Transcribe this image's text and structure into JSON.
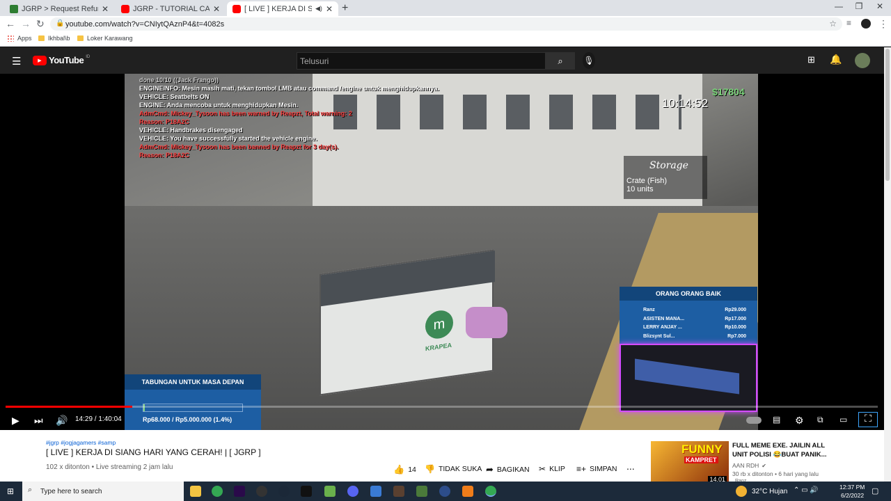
{
  "browser": {
    "tabs": [
      {
        "title": "JGRP > Request Refund - Jogjag",
        "favicon_color": "#2e7d32",
        "active": false
      },
      {
        "title": "JGRP - TUTORIAL CARA MEMBUA",
        "favicon_color": "#ff0000",
        "active": false
      },
      {
        "title": "[ LIVE ] KERJA DI SIANG HAR",
        "favicon_color": "#ff0000",
        "active": true
      }
    ],
    "url": "youtube.com/watch?v=CNIytQAznP4&t=4082s",
    "bookmarks": [
      "Apps",
      "Ikhbal\\b",
      "Loker Karawang"
    ]
  },
  "youtube": {
    "logo_text": "YouTube",
    "region": "ID",
    "search_placeholder": "Telusuri"
  },
  "video_overlay": {
    "chat_lines": [
      {
        "text": "done 10/10 ((Jack Frango))",
        "color": "#cccccc"
      },
      {
        "text": "ENGINEINFO: Mesin masih mati, tekan tombol LMB atau command /engine untuk menghidupkannya.",
        "color": "#ffffff"
      },
      {
        "text": "VEHICLE: Seatbelts ON",
        "color": "#ffffff"
      },
      {
        "text": "ENGINE: Anda mencoba untuk menghidupkan Mesin.",
        "color": "#ffffff"
      },
      {
        "text": "AdmCmd: Mickey_Tysoon has been warned by Reapzt, Total warning: 2",
        "color": "#ff4444"
      },
      {
        "text": "Reason: P18A2C",
        "color": "#ff4444"
      },
      {
        "text": "VEHICLE: Handbrakes disengaged",
        "color": "#ffffff"
      },
      {
        "text": "VEHICLE: You have successfully started the vehicle engine.",
        "color": "#ffffff"
      },
      {
        "text": "AdmCmd: Mickey_Tysoon has been banned by Reapzt for 3 day(s).",
        "color": "#ff4444"
      },
      {
        "text": "Reason: P18A2C",
        "color": "#ff4444"
      }
    ],
    "money": "$17804",
    "clock": "10:14:52",
    "storage_title": "Storage",
    "storage_item": "Crate (Fish)",
    "storage_units": "10 units",
    "donors_title": "ORANG ORANG BAIK",
    "donors": [
      {
        "name": "Ranz",
        "amount": "Rp29.000"
      },
      {
        "name": "ASISTEN MANA...",
        "amount": "Rp17.000"
      },
      {
        "name": "LERRY ANJAY ...",
        "amount": "Rp10.000"
      },
      {
        "name": "Blizsynt Sul...",
        "amount": "Rp7.000"
      }
    ],
    "savings_title": "TABUNGAN UNTUK MASA DEPAN",
    "savings_progress": "Rp68.000 / Rp5.000.000 (1.4%)",
    "savings_fraction": 0.014,
    "truck_brand": "KRAPEA"
  },
  "player": {
    "time_current": "14:29",
    "time_total": "1:40:04",
    "progress_fraction": 0.145
  },
  "video_info": {
    "hashtags": "#jgrp #jogjagamers #samp",
    "title": "[ LIVE ] KERJA DI SIANG HARI YANG CERAH! | [ JGRP ]",
    "views": "102 x ditonton • Live streaming 2 jam lalu",
    "likes": "14",
    "dislike_label": "TIDAK SUKA",
    "share_label": "BAGIKAN",
    "clip_label": "KLIP",
    "save_label": "SIMPAN",
    "more": "..."
  },
  "recommendation": {
    "title_line1": "FULL MEME EXE. JAILIN ALL",
    "title_line2": "UNIT POLISI 😂BUAT PANIK...",
    "channel": "AAN RDH",
    "stats": "30 rb x ditonton • 6 hari yang lalu",
    "duration": "14.01",
    "thumb_text_top": "FUNNY",
    "thumb_text_mid": "KAMPRET",
    "extra": "Ranz"
  },
  "taskbar": {
    "search_placeholder": "Type here to search",
    "weather": "32°C  Hujan",
    "time": "12:37 PM",
    "date": "6/2/2022"
  }
}
